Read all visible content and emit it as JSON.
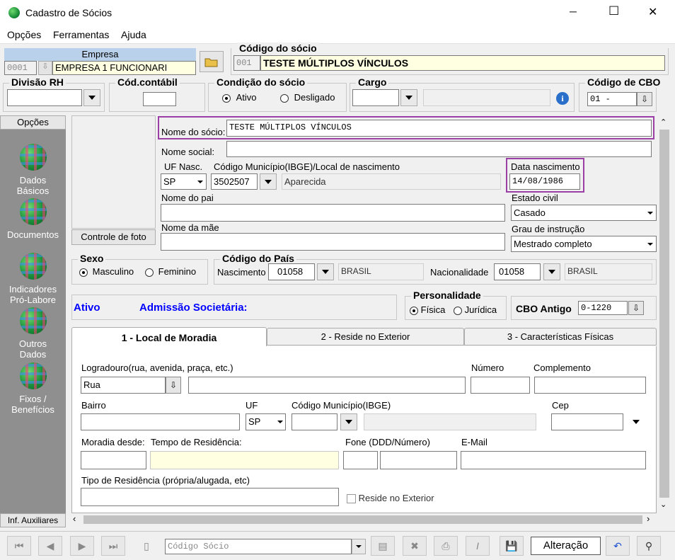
{
  "window": {
    "title": "Cadastro de Sócios",
    "minimize": "─",
    "maximize": "☐",
    "close": "✕"
  },
  "menu": [
    "Opções",
    "Ferramentas",
    "Ajuda"
  ],
  "empresa": {
    "header": "Empresa",
    "code": "0001",
    "name": "EMPRESA 1 FUNCIONARI"
  },
  "codigo_socio": {
    "label": "Código do sócio",
    "code": "001",
    "name": "TESTE MÚLTIPLOS VÍNCULOS"
  },
  "divisao_rh": {
    "label": "Divisão RH",
    "value": ""
  },
  "cod_contabil": {
    "label": "Cód.contábil",
    "value": ""
  },
  "condicao": {
    "label": "Condição do sócio",
    "ativo": "Ativo",
    "desligado": "Desligado"
  },
  "cargo": {
    "label": "Cargo",
    "value": ""
  },
  "cbo": {
    "label": "Código de CBO",
    "value": "01  -"
  },
  "sidebar": {
    "header": "Opções",
    "items": [
      {
        "label": "Dados\nBásicos"
      },
      {
        "label": "Documentos"
      },
      {
        "label": "Indicadores\nPró-Labore"
      },
      {
        "label": "Outros\nDados"
      },
      {
        "label": "Fixos /\nBenefícios"
      }
    ],
    "footer": "Inf. Auxiliares"
  },
  "photo": {
    "button": "Controle de foto"
  },
  "form": {
    "nome_socio_label": "Nome do sócio:",
    "nome_socio": "TESTE MÚLTIPLOS VÍNCULOS",
    "nome_social_label": "Nome social:",
    "nome_social": "",
    "uf_nasc_label": "UF Nasc.",
    "uf_nasc": "SP",
    "municipio_label": "Código Município(IBGE)/Local de nascimento",
    "municipio_code": "3502507",
    "municipio_name": "Aparecida",
    "data_nasc_label": "Data nascimento",
    "data_nasc": "14/08/1986",
    "pai_label": "Nome do pai",
    "pai": "",
    "estado_civil_label": "Estado civil",
    "estado_civil": "Casado",
    "mae_label": "Nome da mãe",
    "mae": "",
    "grau_label": "Grau de instrução",
    "grau": "Mestrado completo"
  },
  "sexo": {
    "label": "Sexo",
    "masculino": "Masculino",
    "feminino": "Feminino"
  },
  "pais": {
    "label": "Código do País",
    "nascimento_label": "Nascimento",
    "nascimento_code": "01058",
    "nascimento_name": "BRASIL",
    "nacionalidade_label": "Nacionalidade",
    "nacionalidade_code": "01058",
    "nacionalidade_name": "BRASIL"
  },
  "status": {
    "ativo": "Ativo",
    "admissao": "Admissão Societária:"
  },
  "personalidade": {
    "label": "Personalidade",
    "fisica": "Física",
    "juridica": "Jurídica"
  },
  "cbo_antigo": {
    "label": "CBO Antigo",
    "value": "0-1220"
  },
  "tabs": [
    "1 - Local de Moradia",
    "2 - Reside no Exterior",
    "3 - Características Físicas"
  ],
  "moradia": {
    "logradouro_label": "Logradouro(rua, avenida, praça, etc.)",
    "logradouro_tipo": "Rua",
    "logradouro": "",
    "numero_label": "Número",
    "numero": "",
    "complemento_label": "Complemento",
    "complemento": "",
    "bairro_label": "Bairro",
    "bairro": "",
    "uf_label": "UF",
    "uf": "SP",
    "municipio_label": "Código Município(IBGE)",
    "municipio": "",
    "cep_label": "Cep",
    "cep": "",
    "moradia_desde_label": "Moradia desde:",
    "moradia_desde": "",
    "tempo_label": "Tempo de Residência:",
    "tempo": "",
    "fone_label": "Fone (DDD/Número)",
    "ddd": "",
    "fone": "",
    "email_label": "E-Mail",
    "email": "",
    "tipo_label": "Tipo de Residência  (própria/alugada, etc)",
    "tipo": "",
    "reside_exterior": "Reside no Exterior"
  },
  "toolbar": {
    "codigo_placeholder": "Código Sócio",
    "mode": "Alteração"
  },
  "colors": {
    "highlight": "#9b3fa6",
    "blue": "#0000ff",
    "sidebar": "#8f8f8f"
  }
}
